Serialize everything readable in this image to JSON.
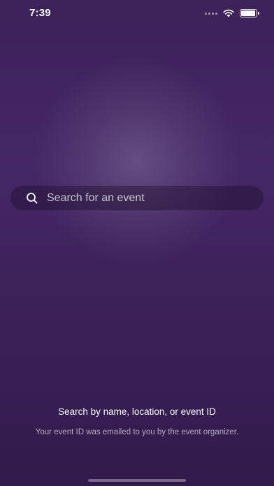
{
  "status_bar": {
    "time": "7:39",
    "battery_level": 0.95
  },
  "search": {
    "placeholder": "Search for an event",
    "icon": "search-icon"
  },
  "help": {
    "title": "Search by name, location, or event ID",
    "subtitle": "Your event ID was emailed to you by the event organizer."
  },
  "colors": {
    "background_top": "#3d2159",
    "background_bottom": "#321a4b",
    "text": "#ffffff"
  }
}
